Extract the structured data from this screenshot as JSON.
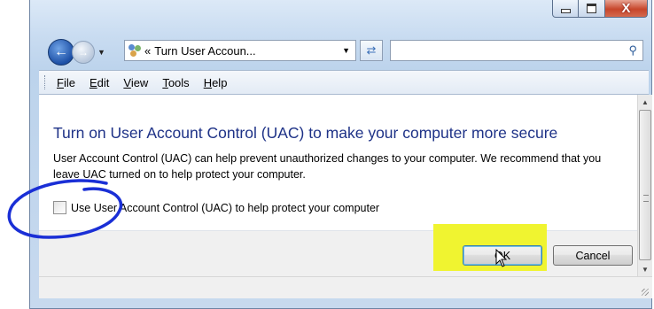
{
  "window": {
    "min_icon": "minimize-icon",
    "max_icon": "maximize-icon",
    "close_icon": "close-icon",
    "close_glyph": "X"
  },
  "nav": {
    "back_icon": "back-arrow-icon",
    "forward_icon": "forward-arrow-icon",
    "address_text": "Turn User Accoun...",
    "address_prefix": "«",
    "refresh_icon": "refresh-icon",
    "search_placeholder": "",
    "search_icon": "search-icon"
  },
  "menu": {
    "items": [
      "File",
      "Edit",
      "View",
      "Tools",
      "Help"
    ]
  },
  "content": {
    "title": "Turn on User Account Control (UAC) to make your computer more secure",
    "description": "User Account Control (UAC) can help prevent unauthorized changes to your computer.  We recommend that you leave UAC turned on to help protect your computer.",
    "checkbox_label": "Use User Account Control (UAC) to help protect your computer",
    "checkbox_checked": false
  },
  "buttons": {
    "ok": "OK",
    "cancel": "Cancel"
  },
  "colors": {
    "title": "#1e3287",
    "highlight": "#f0f430",
    "annotation_circle": "#1a2fd6"
  }
}
